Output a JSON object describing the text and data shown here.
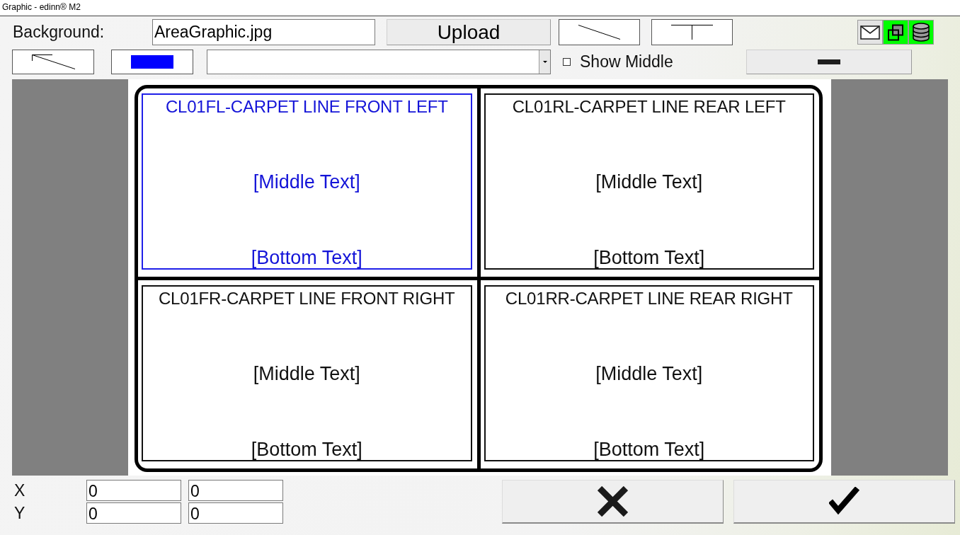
{
  "window": {
    "title": "Graphic - edinn® M2"
  },
  "toolbar": {
    "background": {
      "label": "Background:",
      "value": "AreaGraphic.jpg"
    },
    "upload_button": "Upload",
    "toggles": [
      {
        "kind": "mail",
        "on": false
      },
      {
        "kind": "layers",
        "on": true
      },
      {
        "kind": "database",
        "on": true
      }
    ],
    "color_button": {
      "color": "#0000ff"
    },
    "show_middle": {
      "label": "Show Middle",
      "checked": false
    }
  },
  "canvas": {
    "areas": [
      {
        "title": "CL01FL-CARPET LINE FRONT LEFT",
        "middle_text": "[Middle Text]",
        "bottom_text": "[Bottom Text]",
        "selected": true
      },
      {
        "title": "CL01RL-CARPET LINE REAR LEFT",
        "middle_text": "[Middle Text]",
        "bottom_text": "[Bottom Text]",
        "selected": false
      },
      {
        "title": "CL01FR-CARPET LINE FRONT RIGHT",
        "middle_text": "[Middle Text]",
        "bottom_text": "[Bottom Text]",
        "selected": false
      },
      {
        "title": "CL01RR-CARPET LINE REAR RIGHT",
        "middle_text": "[Middle Text]",
        "bottom_text": "[Bottom Text]",
        "selected": false
      }
    ]
  },
  "coordinates": [
    {
      "label": "X",
      "values": [
        "0",
        "0"
      ]
    },
    {
      "label": "Y",
      "values": [
        "0",
        "0"
      ]
    }
  ]
}
